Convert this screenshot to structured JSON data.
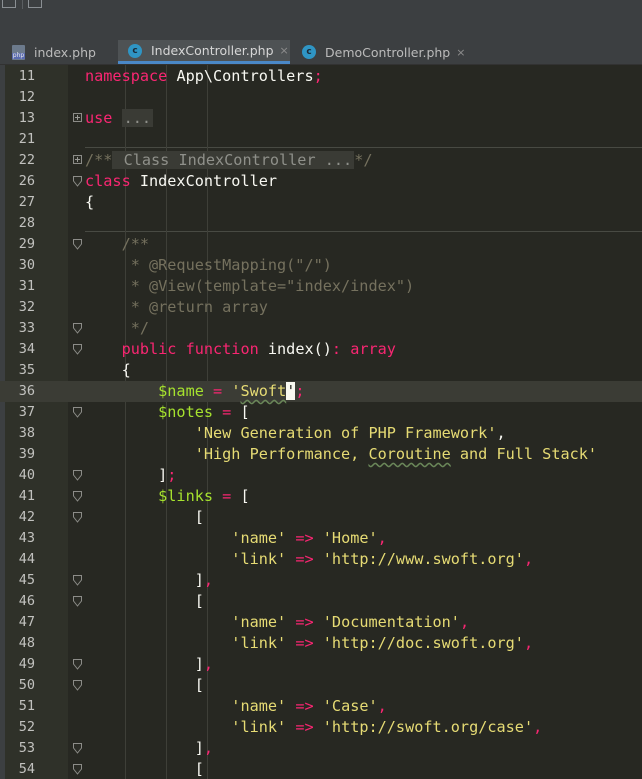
{
  "tabs": [
    {
      "label": "index.php",
      "icon": "php-file-icon",
      "active": false
    },
    {
      "label": "IndexController.php",
      "icon": "php-class-icon",
      "active": true
    },
    {
      "label": "DemoController.php",
      "icon": "php-class-icon",
      "active": false
    }
  ],
  "tab_close_glyph": "×",
  "colors": {
    "keyword": "#f92672",
    "string": "#e6db74",
    "variable": "#a6e22e",
    "comment": "#75715e",
    "background": "#272822",
    "tab_active_underline": "#4a88c7"
  },
  "editor": {
    "lines": [
      {
        "n": "11",
        "segs": [
          [
            "kw",
            "namespace"
          ],
          [
            "nm",
            " App\\Controllers"
          ],
          [
            "kw",
            ";"
          ]
        ]
      },
      {
        "n": "12",
        "segs": []
      },
      {
        "n": "13",
        "fold": "plus",
        "segs": [
          [
            "kw",
            "use"
          ],
          [
            "nm",
            " "
          ],
          [
            "fld",
            "..."
          ]
        ]
      },
      {
        "n": "21",
        "segs": []
      },
      {
        "n": "22",
        "fold": "plus",
        "segs": [
          [
            "cm",
            "/**"
          ],
          [
            "fld",
            " Class IndexController ..."
          ],
          [
            "cm",
            "*/"
          ]
        ]
      },
      {
        "n": "26",
        "fold": "minus-arrow",
        "segs": [
          [
            "kw",
            "class"
          ],
          [
            "nm",
            " IndexController"
          ]
        ]
      },
      {
        "n": "27",
        "segs": [
          [
            "nm",
            "{"
          ]
        ]
      },
      {
        "n": "28",
        "segs": []
      },
      {
        "n": "29",
        "fold": "arrow",
        "segs": [
          [
            "cm",
            "    /**"
          ]
        ]
      },
      {
        "n": "30",
        "segs": [
          [
            "cm",
            "     * @RequestMapping(\"/\")"
          ]
        ]
      },
      {
        "n": "31",
        "segs": [
          [
            "cm",
            "     * @View(template=\"index/index\")"
          ]
        ]
      },
      {
        "n": "32",
        "segs": [
          [
            "cm",
            "     * @return array"
          ]
        ]
      },
      {
        "n": "33",
        "fold": "arrow",
        "segs": [
          [
            "cm",
            "     */"
          ]
        ]
      },
      {
        "n": "34",
        "fold": "arrow",
        "segs": [
          [
            "kw",
            "    public"
          ],
          [
            "nm",
            " "
          ],
          [
            "kw",
            "function"
          ],
          [
            "nm",
            " index()"
          ],
          [
            "op",
            ":"
          ],
          [
            "nm",
            " "
          ],
          [
            "ty",
            "array"
          ]
        ]
      },
      {
        "n": "35",
        "segs": [
          [
            "nm",
            "    {"
          ]
        ]
      },
      {
        "n": "36",
        "current": true,
        "segs": [
          [
            "var",
            "        $name"
          ],
          [
            "nm",
            " "
          ],
          [
            "op",
            "="
          ],
          [
            "nm",
            " "
          ],
          [
            "str",
            "'"
          ],
          [
            "sq",
            "Swoft"
          ],
          [
            "caret",
            "'"
          ],
          [
            "kw",
            ";"
          ]
        ]
      },
      {
        "n": "37",
        "fold": "arrow",
        "segs": [
          [
            "var",
            "        $notes"
          ],
          [
            "nm",
            " "
          ],
          [
            "op",
            "="
          ],
          [
            "nm",
            " ["
          ]
        ]
      },
      {
        "n": "38",
        "segs": [
          [
            "str",
            "            'New Generation of PHP Framework'"
          ],
          [
            "nm",
            ","
          ]
        ]
      },
      {
        "n": "39",
        "segs": [
          [
            "str",
            "            'High Performance, "
          ],
          [
            "sqs",
            "Coroutine"
          ],
          [
            "str",
            " and Full Stack'"
          ]
        ]
      },
      {
        "n": "40",
        "fold": "arrow",
        "segs": [
          [
            "nm",
            "        ]"
          ],
          [
            "kw",
            ";"
          ]
        ]
      },
      {
        "n": "41",
        "fold": "arrow",
        "segs": [
          [
            "var",
            "        $links"
          ],
          [
            "nm",
            " "
          ],
          [
            "op",
            "="
          ],
          [
            "nm",
            " ["
          ]
        ]
      },
      {
        "n": "42",
        "fold": "arrow",
        "segs": [
          [
            "nm",
            "            ["
          ]
        ]
      },
      {
        "n": "43",
        "segs": [
          [
            "str",
            "                'name'"
          ],
          [
            "nm",
            " "
          ],
          [
            "op",
            "=>"
          ],
          [
            "nm",
            " "
          ],
          [
            "str",
            "'Home'"
          ],
          [
            "kw",
            ","
          ]
        ]
      },
      {
        "n": "44",
        "segs": [
          [
            "str",
            "                'link'"
          ],
          [
            "nm",
            " "
          ],
          [
            "op",
            "=>"
          ],
          [
            "nm",
            " "
          ],
          [
            "str",
            "'http://www.swoft.org'"
          ],
          [
            "kw",
            ","
          ]
        ]
      },
      {
        "n": "45",
        "fold": "arrow",
        "segs": [
          [
            "nm",
            "            ]"
          ],
          [
            "kw",
            ","
          ]
        ]
      },
      {
        "n": "46",
        "fold": "arrow",
        "segs": [
          [
            "nm",
            "            ["
          ]
        ]
      },
      {
        "n": "47",
        "segs": [
          [
            "str",
            "                'name'"
          ],
          [
            "nm",
            " "
          ],
          [
            "op",
            "=>"
          ],
          [
            "nm",
            " "
          ],
          [
            "str",
            "'Documentation'"
          ],
          [
            "kw",
            ","
          ]
        ]
      },
      {
        "n": "48",
        "segs": [
          [
            "str",
            "                'link'"
          ],
          [
            "nm",
            " "
          ],
          [
            "op",
            "=>"
          ],
          [
            "nm",
            " "
          ],
          [
            "str",
            "'http://doc.swoft.org'"
          ],
          [
            "kw",
            ","
          ]
        ]
      },
      {
        "n": "49",
        "fold": "arrow",
        "segs": [
          [
            "nm",
            "            ]"
          ],
          [
            "kw",
            ","
          ]
        ]
      },
      {
        "n": "50",
        "fold": "arrow",
        "segs": [
          [
            "nm",
            "            ["
          ]
        ]
      },
      {
        "n": "51",
        "segs": [
          [
            "str",
            "                'name'"
          ],
          [
            "nm",
            " "
          ],
          [
            "op",
            "=>"
          ],
          [
            "nm",
            " "
          ],
          [
            "str",
            "'Case'"
          ],
          [
            "kw",
            ","
          ]
        ]
      },
      {
        "n": "52",
        "segs": [
          [
            "str",
            "                'link'"
          ],
          [
            "nm",
            " "
          ],
          [
            "op",
            "=>"
          ],
          [
            "nm",
            " "
          ],
          [
            "str",
            "'http://swoft.org/case'"
          ],
          [
            "kw",
            ","
          ]
        ]
      },
      {
        "n": "53",
        "fold": "arrow",
        "segs": [
          [
            "nm",
            "            ]"
          ],
          [
            "kw",
            ","
          ]
        ]
      },
      {
        "n": "54",
        "fold": "arrow",
        "segs": [
          [
            "nm",
            "            ["
          ]
        ]
      }
    ]
  }
}
